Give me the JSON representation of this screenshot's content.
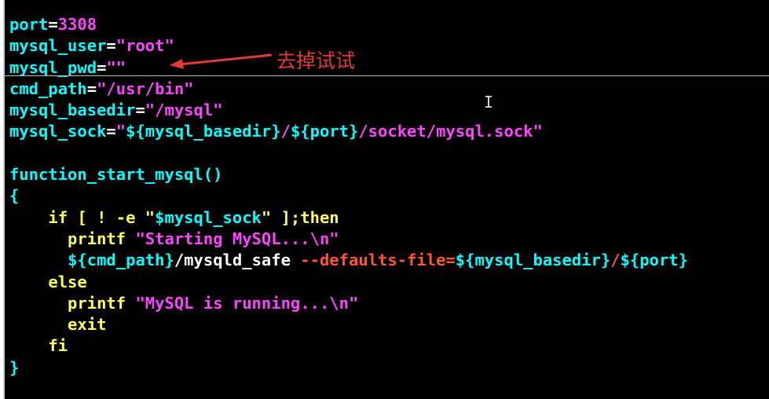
{
  "colors": {
    "var": "#00ffff",
    "op": "#ffffff",
    "num": "#ff44ff",
    "str": "#ff44ff",
    "kw": "#ffff55",
    "brace": "#00ffff",
    "fn": "#00ffff",
    "flag": "#ff5533",
    "plain": "#ffffff",
    "annotation": "#e53935"
  },
  "annotation": {
    "text": "去掉试试",
    "icon": "arrow-left-icon"
  },
  "cursor_icon": "text-ibeam-icon",
  "lines": [
    [
      {
        "t": "port",
        "c": "var"
      },
      {
        "t": "=",
        "c": "op"
      },
      {
        "t": "3308",
        "c": "num"
      }
    ],
    [
      {
        "t": "mysql_user",
        "c": "var"
      },
      {
        "t": "=",
        "c": "op"
      },
      {
        "t": "\"root\"",
        "c": "str"
      }
    ],
    [
      {
        "t": "mysql_pwd",
        "c": "var"
      },
      {
        "t": "=",
        "c": "op"
      },
      {
        "t": "\"\"",
        "c": "str"
      }
    ],
    [
      {
        "t": "cmd_path",
        "c": "var"
      },
      {
        "t": "=",
        "c": "op"
      },
      {
        "t": "\"/usr/bin\"",
        "c": "str"
      }
    ],
    [
      {
        "t": "mysql_basedir",
        "c": "var"
      },
      {
        "t": "=",
        "c": "op"
      },
      {
        "t": "\"/mysql\"",
        "c": "str"
      }
    ],
    [
      {
        "t": "mysql_sock",
        "c": "var"
      },
      {
        "t": "=",
        "c": "op"
      },
      {
        "t": "\"",
        "c": "str"
      },
      {
        "t": "${mysql_basedir}",
        "c": "var"
      },
      {
        "t": "/",
        "c": "str"
      },
      {
        "t": "${port}",
        "c": "var"
      },
      {
        "t": "/socket/mysql.sock\"",
        "c": "str"
      }
    ],
    [],
    [
      {
        "t": "function_start_mysql()",
        "c": "fn"
      }
    ],
    [
      {
        "t": "{",
        "c": "brace"
      }
    ],
    [
      {
        "t": "    if [ ! -e \"",
        "c": "kw"
      },
      {
        "t": "$mysql_sock",
        "c": "var"
      },
      {
        "t": "\" ];then",
        "c": "kw"
      }
    ],
    [
      {
        "t": "      printf ",
        "c": "kw"
      },
      {
        "t": "\"Starting MySQL...\\n\"",
        "c": "str"
      }
    ],
    [
      {
        "t": "      ",
        "c": "plain"
      },
      {
        "t": "${cmd_path}",
        "c": "var"
      },
      {
        "t": "/mysqld_safe ",
        "c": "plain"
      },
      {
        "t": "--defaults-file=",
        "c": "flag"
      },
      {
        "t": "${mysql_basedir}",
        "c": "var"
      },
      {
        "t": "/",
        "c": "flag"
      },
      {
        "t": "${port}",
        "c": "var"
      }
    ],
    [
      {
        "t": "    else",
        "c": "kw"
      }
    ],
    [
      {
        "t": "      printf ",
        "c": "kw"
      },
      {
        "t": "\"MySQL is running...\\n\"",
        "c": "str"
      }
    ],
    [
      {
        "t": "      exit",
        "c": "kw"
      }
    ],
    [
      {
        "t": "    fi",
        "c": "kw"
      }
    ],
    [
      {
        "t": "}",
        "c": "brace"
      }
    ]
  ]
}
